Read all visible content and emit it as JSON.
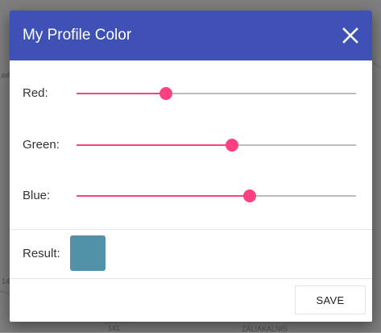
{
  "dialog": {
    "title": "My Profile Color",
    "close_icon": "close-icon",
    "header_color": "#3f51b5",
    "accent_color": "#ff4081"
  },
  "sliders": [
    {
      "label": "Red:",
      "fraction": 0.32
    },
    {
      "label": "Green:",
      "fraction": 0.555
    },
    {
      "label": "Blue:",
      "fraction": 0.62
    }
  ],
  "result": {
    "label": "Result:",
    "color": "#5292a8"
  },
  "actions": {
    "save_label": "SAVE"
  },
  "background_map": {
    "labels": [
      "ed",
      "14",
      "141",
      "ZALIAKALNIS"
    ]
  }
}
